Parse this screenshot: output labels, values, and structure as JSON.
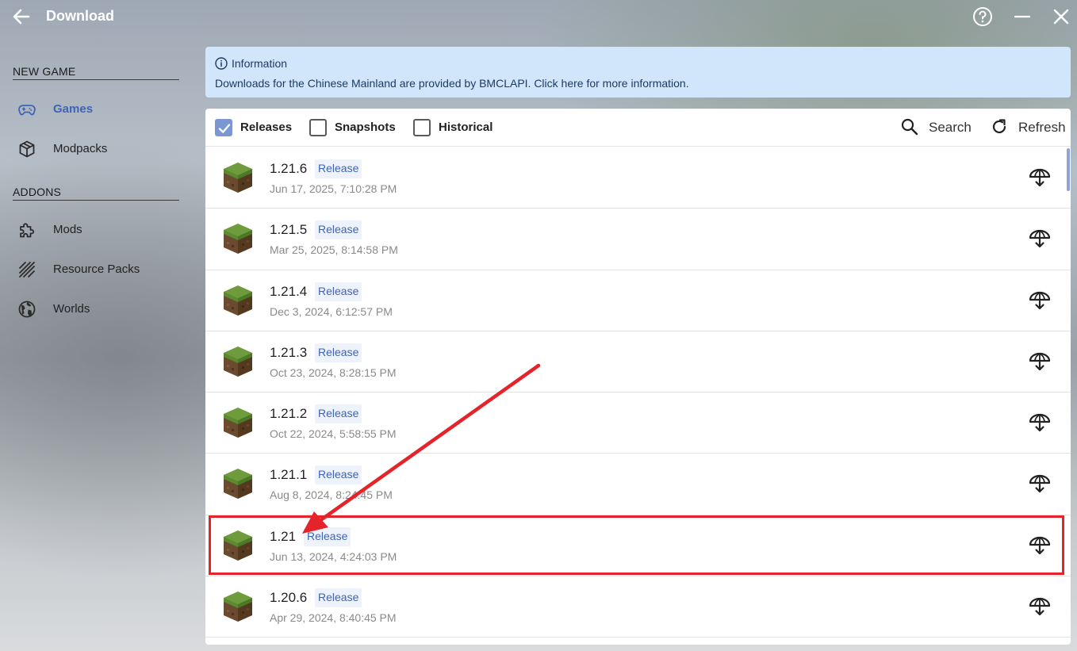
{
  "header": {
    "title": "Download"
  },
  "sidebar": {
    "sections": [
      {
        "title": "NEW GAME"
      },
      {
        "title": "ADDONS"
      }
    ],
    "items": [
      {
        "label": "Games",
        "icon": "gamepad-icon",
        "active": true
      },
      {
        "label": "Modpacks",
        "icon": "package-icon"
      },
      {
        "label": "Mods",
        "icon": "puzzle-icon"
      },
      {
        "label": "Resource Packs",
        "icon": "texture-icon"
      },
      {
        "label": "Worlds",
        "icon": "globe-icon"
      }
    ]
  },
  "info": {
    "title": "Information",
    "text": "Downloads for the Chinese Mainland are provided by BMCLAPI. Click here for more information."
  },
  "filters": {
    "releases": {
      "label": "Releases",
      "checked": true
    },
    "snapshots": {
      "label": "Snapshots",
      "checked": false
    },
    "historical": {
      "label": "Historical",
      "checked": false
    }
  },
  "toolbar": {
    "search_label": "Search",
    "refresh_label": "Refresh"
  },
  "versions": [
    {
      "version": "1.21.6",
      "type": "Release",
      "date": "Jun 17, 2025, 7:10:28 PM"
    },
    {
      "version": "1.21.5",
      "type": "Release",
      "date": "Mar 25, 2025, 8:14:58 PM"
    },
    {
      "version": "1.21.4",
      "type": "Release",
      "date": "Dec 3, 2024, 6:12:57 PM"
    },
    {
      "version": "1.21.3",
      "type": "Release",
      "date": "Oct 23, 2024, 8:28:15 PM"
    },
    {
      "version": "1.21.2",
      "type": "Release",
      "date": "Oct 22, 2024, 5:58:55 PM"
    },
    {
      "version": "1.21.1",
      "type": "Release",
      "date": "Aug 8, 2024, 8:24:45 PM"
    },
    {
      "version": "1.21",
      "type": "Release",
      "date": "Jun 13, 2024, 4:24:03 PM",
      "highlighted": true
    },
    {
      "version": "1.20.6",
      "type": "Release",
      "date": "Apr 29, 2024, 8:40:45 PM"
    }
  ],
  "colors": {
    "accent": "#3e64b8",
    "info_bg": "#d1e6fb",
    "annotation": "#e4232b"
  }
}
